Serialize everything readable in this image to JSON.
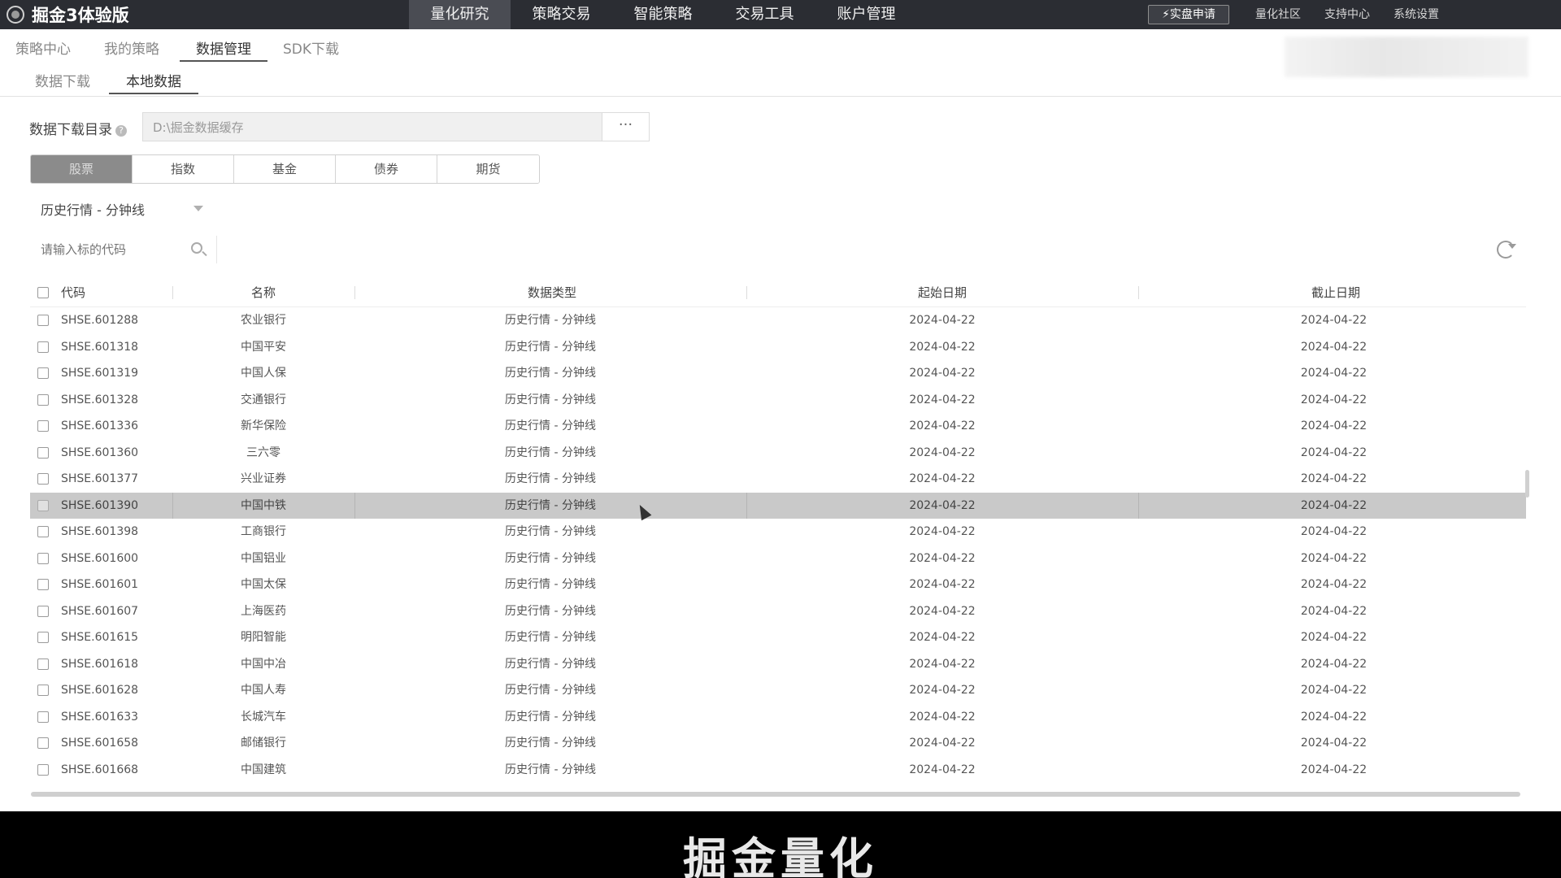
{
  "app": {
    "title": "掘金3体验版"
  },
  "topnav": [
    {
      "label": "量化研究",
      "active": true
    },
    {
      "label": "策略交易"
    },
    {
      "label": "智能策略"
    },
    {
      "label": "交易工具"
    },
    {
      "label": "账户管理"
    }
  ],
  "top_right": {
    "real_button": "实盘申请",
    "links": [
      "量化社区",
      "支持中心",
      "系统设置"
    ]
  },
  "subnav": [
    {
      "label": "策略中心"
    },
    {
      "label": "我的策略"
    },
    {
      "label": "数据管理",
      "active": true
    },
    {
      "label": "SDK下载"
    }
  ],
  "subnav2": [
    {
      "label": "数据下载"
    },
    {
      "label": "本地数据",
      "active": true
    }
  ],
  "directory": {
    "label": "数据下载目录",
    "help": "?",
    "value": "D:\\掘金数据缓存",
    "browse_label": "···"
  },
  "categories": [
    {
      "label": "股票",
      "active": true
    },
    {
      "label": "指数"
    },
    {
      "label": "基金"
    },
    {
      "label": "债券"
    },
    {
      "label": "期货"
    }
  ],
  "data_type_select": {
    "value": "历史行情 - 分钟线"
  },
  "search": {
    "placeholder": "请输入标的代码"
  },
  "table": {
    "columns": [
      "代码",
      "名称",
      "数据类型",
      "起始日期",
      "截止日期"
    ],
    "selected_row": 7,
    "rows": [
      [
        "SHSE.601288",
        "农业银行",
        "历史行情 - 分钟线",
        "2024-04-22",
        "2024-04-22"
      ],
      [
        "SHSE.601318",
        "中国平安",
        "历史行情 - 分钟线",
        "2024-04-22",
        "2024-04-22"
      ],
      [
        "SHSE.601319",
        "中国人保",
        "历史行情 - 分钟线",
        "2024-04-22",
        "2024-04-22"
      ],
      [
        "SHSE.601328",
        "交通银行",
        "历史行情 - 分钟线",
        "2024-04-22",
        "2024-04-22"
      ],
      [
        "SHSE.601336",
        "新华保险",
        "历史行情 - 分钟线",
        "2024-04-22",
        "2024-04-22"
      ],
      [
        "SHSE.601360",
        "三六零",
        "历史行情 - 分钟线",
        "2024-04-22",
        "2024-04-22"
      ],
      [
        "SHSE.601377",
        "兴业证券",
        "历史行情 - 分钟线",
        "2024-04-22",
        "2024-04-22"
      ],
      [
        "SHSE.601390",
        "中国中铁",
        "历史行情 - 分钟线",
        "2024-04-22",
        "2024-04-22"
      ],
      [
        "SHSE.601398",
        "工商银行",
        "历史行情 - 分钟线",
        "2024-04-22",
        "2024-04-22"
      ],
      [
        "SHSE.601600",
        "中国铝业",
        "历史行情 - 分钟线",
        "2024-04-22",
        "2024-04-22"
      ],
      [
        "SHSE.601601",
        "中国太保",
        "历史行情 - 分钟线",
        "2024-04-22",
        "2024-04-22"
      ],
      [
        "SHSE.601607",
        "上海医药",
        "历史行情 - 分钟线",
        "2024-04-22",
        "2024-04-22"
      ],
      [
        "SHSE.601615",
        "明阳智能",
        "历史行情 - 分钟线",
        "2024-04-22",
        "2024-04-22"
      ],
      [
        "SHSE.601618",
        "中国中冶",
        "历史行情 - 分钟线",
        "2024-04-22",
        "2024-04-22"
      ],
      [
        "SHSE.601628",
        "中国人寿",
        "历史行情 - 分钟线",
        "2024-04-22",
        "2024-04-22"
      ],
      [
        "SHSE.601633",
        "长城汽车",
        "历史行情 - 分钟线",
        "2024-04-22",
        "2024-04-22"
      ],
      [
        "SHSE.601658",
        "邮储银行",
        "历史行情 - 分钟线",
        "2024-04-22",
        "2024-04-22"
      ],
      [
        "SHSE.601668",
        "中国建筑",
        "历史行情 - 分钟线",
        "2024-04-22",
        "2024-04-22"
      ]
    ]
  },
  "caption": "掘金量化"
}
